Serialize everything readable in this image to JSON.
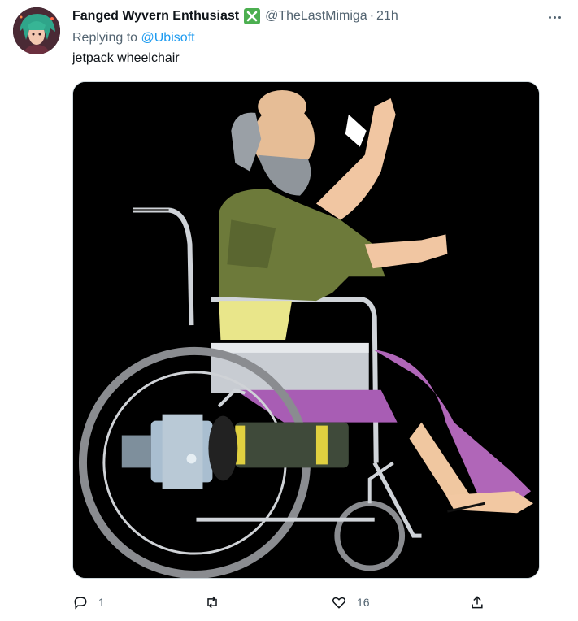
{
  "author": {
    "display_name": "Fanged Wyvern Enthusiast",
    "handle": "@TheLastMimiga",
    "separator": "·",
    "timestamp": "21h",
    "badge_icon": "green-x-badge-icon"
  },
  "reply": {
    "prefix": "Replying to",
    "target": "@Ubisoft"
  },
  "tweet_text": "jetpack wheelchair",
  "media": {
    "description_icon": "jetpack-wheelchair-image"
  },
  "actions": {
    "reply_count": "1",
    "retweet_count": "",
    "like_count": "16",
    "share_count": ""
  },
  "colors": {
    "link": "#1d9bf0",
    "muted": "#536471",
    "badge": "#4caf50"
  }
}
